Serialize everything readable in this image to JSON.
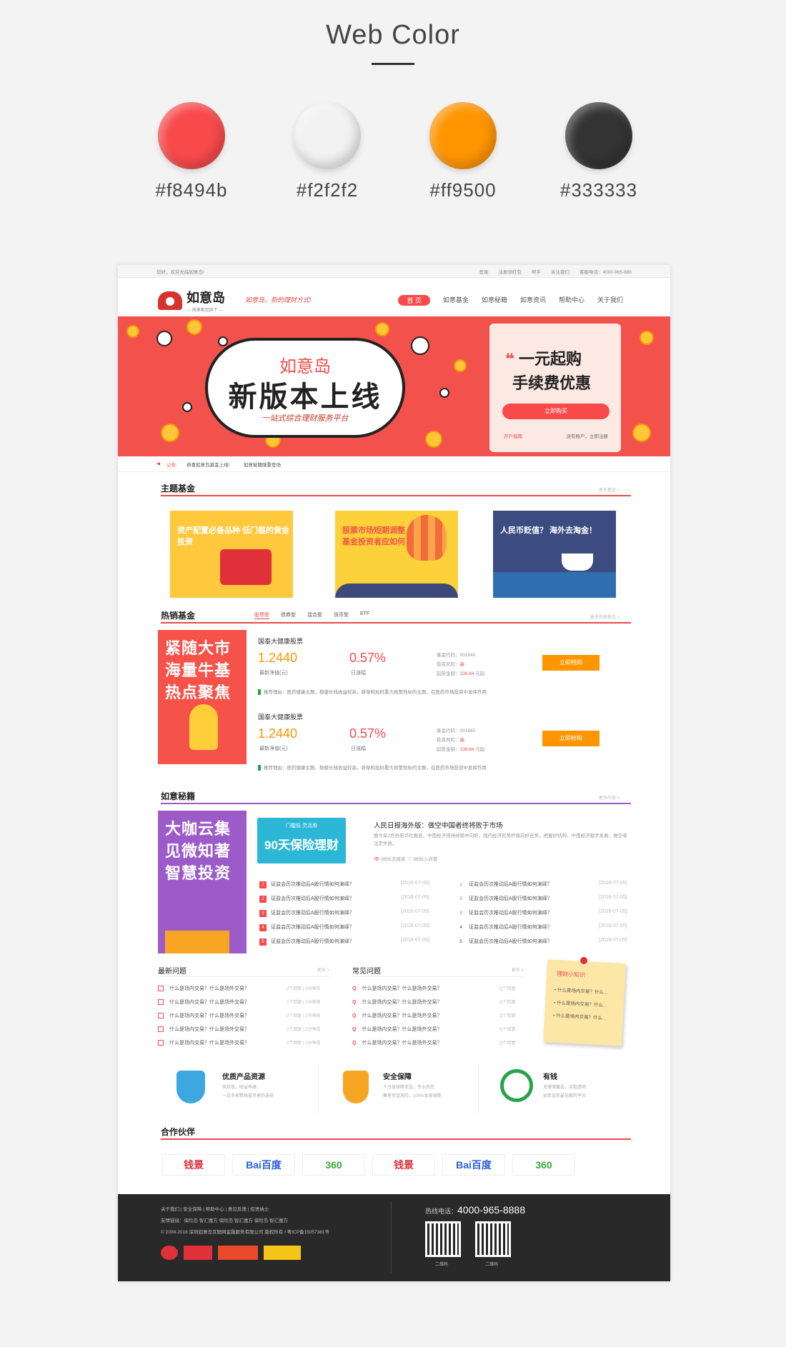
{
  "palette": {
    "title": "Web Color",
    "swatches": [
      {
        "hex": "#f8494b",
        "label": "#f8494b"
      },
      {
        "hex": "#f2f2f2",
        "label": "#f2f2f2"
      },
      {
        "hex": "#ff9500",
        "label": "#ff9500"
      },
      {
        "hex": "#333333",
        "label": "#333333"
      }
    ]
  },
  "topbar": {
    "welcome": "您好，欢迎光临如意岛!",
    "links": [
      "登录",
      "注册领红包",
      "帮手",
      "关注我们",
      "客服电话：4000-965-888"
    ]
  },
  "header": {
    "logo": "如意岛",
    "logo_sub": "— 鼎聚集团旗下 —",
    "slogan": "如意岛，新的理财方式!",
    "nav": [
      "首 页",
      "如意基金",
      "如意秘籍",
      "如意资讯",
      "帮助中心",
      "关于我们"
    ]
  },
  "banner": {
    "line1": "如意岛",
    "line2": "新版本上线",
    "line3": "一站式综合理财服务平台",
    "card_h1": "一元起购",
    "card_h2": "手续费优惠",
    "cta": "立即购买",
    "link_left": "开户指南",
    "link_right": "没有账户，立即注册"
  },
  "notice": {
    "label": "公告:",
    "items": [
      "恭喜如意岛基金上线!",
      "如意秘籍隆重登场"
    ]
  },
  "theme": {
    "title": "主题基金",
    "more": "更多基金 >",
    "tiles": [
      "资产配置必备品种 低门槛的黄金投资",
      "股票市场短期调整 基金投资者应如何",
      "人民币贬值？ 海外去淘金！"
    ]
  },
  "hot": {
    "title": "热销基金",
    "more": "更多热销基金 >",
    "tabs": [
      "股票型",
      "债券型",
      "混合型",
      "货币型",
      "ETF"
    ],
    "promo": "紧随大市 海量牛基 热点聚焦",
    "funds": [
      {
        "name": "国泰大健康股票",
        "nav": "1.2440",
        "nav_label": "最新净值(元)",
        "change": "0.57%",
        "change_label": "日涨幅",
        "info1": "基金代码：001645",
        "info2": "投资风险：",
        "risk": "高",
        "info3": "起投金额：",
        "amount": "136.84",
        "unit": "元起",
        "buy": "立即抢购",
        "tip": "推荐理由：医药健康主题，稳健长线收益较高，新架构加码重大政策性标的主题，在医药市场投资中发挥作用"
      },
      {
        "name": "国泰大健康股票",
        "nav": "1.2440",
        "nav_label": "最新净值(元)",
        "change": "0.57%",
        "change_label": "日涨幅",
        "info1": "基金代码：001645",
        "info2": "投资风险：",
        "risk": "高",
        "info3": "起投金额：",
        "amount": "136.84",
        "unit": "元起",
        "buy": "立即抢购",
        "tip": "推荐理由：医药健康主题，稳健长线收益较高，新架构加码重大政策性标的主题，在医药市场投资中发挥作用"
      }
    ]
  },
  "secret": {
    "title": "如意秘籍",
    "more": "更多内容 >",
    "promo": "大咖云集 见微知著 智慧投资",
    "ad_small": "门槛低 灵活用",
    "ad_big": "90天保险理财",
    "article_title": "人民日报海外版：做空中国者终将败于市场",
    "article_desc": "据今年2月份新华社报道，中国经济将持续稳中向好，国内经济形势积极向好走势，把握好结构，中国经济稳步发展，做空者注定失败。",
    "likes": "9955次阅读",
    "favs": "9955人点赞",
    "items": [
      "证监会历次推动后A股行情如何演绎？",
      "证监会历次推动后A股行情如何演绎？",
      "证监会历次推动后A股行情如何演绎？",
      "证监会历次推动后A股行情如何演绎？",
      "证监会历次推动后A股行情如何演绎？"
    ],
    "date": "[2016-07-05]"
  },
  "latest": {
    "title": "最新问题",
    "more": "更多 >",
    "q": "什么是场内交易？什么是场外交易？",
    "meta": "2个回复 | 2分钟前"
  },
  "faq": {
    "title": "常见问题",
    "more": "更多 >",
    "q": "什么是场内交易？什么是场外交易？",
    "meta": "Q个回复"
  },
  "tips": {
    "title": "理财小知识",
    "item": "什么是场内交易？什么..."
  },
  "features": [
    {
      "title": "优质产品资源",
      "desc1": "风险低，收益率高",
      "desc2": "一百多家精挑投资者的选择"
    },
    {
      "title": "安全保障",
      "desc1": "千万级保障资金，专业风控",
      "desc2": "聚焦资金风险，100%本息保障"
    },
    {
      "title": "有钱",
      "desc1": "无需储蓄金，流程透明",
      "desc2": "如意岛你最信赖的平台"
    }
  ],
  "partners": {
    "title": "合作伙伴",
    "names": [
      "钱景",
      "Bai百度",
      "360",
      "钱景",
      "Bai百度",
      "360"
    ]
  },
  "footer": {
    "links1": "关于我们  |  安全保障  |  帮助中心  |  意见反馈  |  招贤纳士",
    "links2": "友情链接：保险岛  智汇魔方  保险岛  智汇魔方  保险岛  智汇魔方",
    "copy": "© 2008-2016 深圳如意岛互联网金融服务有限公司 版权所有 / 粤ICP备15057381号",
    "hotline_label": "热线电话：",
    "hotline": "4000-965-8888",
    "qr1": "二维码",
    "qr2": "二维码"
  },
  "colors": {
    "red": "#f8494b",
    "orange": "#ff9500",
    "dark": "#333333",
    "light": "#f2f2f2"
  }
}
